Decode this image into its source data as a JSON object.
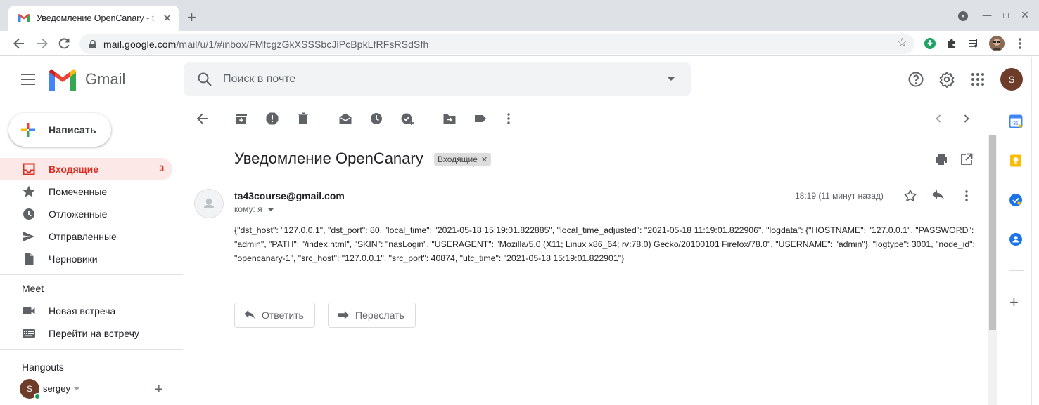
{
  "browser": {
    "tab_title": "Уведомление OpenCanary - t",
    "url_host": "mail.google.com",
    "url_path": "/mail/u/1/#inbox/FMfcgzGkXSSSbcJlPcBpkLfRFsRSdSfh"
  },
  "header": {
    "app_name": "Gmail",
    "search_placeholder": "Поиск в почте",
    "avatar_letter": "S"
  },
  "compose_label": "Написать",
  "nav": [
    {
      "label": "Входящие",
      "count": "3",
      "icon": "inbox-icon"
    },
    {
      "label": "Помеченные",
      "count": "",
      "icon": "star-icon"
    },
    {
      "label": "Отложенные",
      "count": "",
      "icon": "clock-icon"
    },
    {
      "label": "Отправленные",
      "count": "",
      "icon": "send-icon"
    },
    {
      "label": "Черновики",
      "count": "",
      "icon": "draft-icon"
    }
  ],
  "meet": {
    "heading": "Meet",
    "items": [
      "Новая встреча",
      "Перейти на встречу"
    ]
  },
  "hangouts": {
    "heading": "Hangouts",
    "user_name": "sergey",
    "avatar_letter": "S"
  },
  "message": {
    "subject": "Уведомление OpenCanary",
    "label": "Входящие",
    "sender": "ta43course@gmail.com",
    "to": "кому: я",
    "time": "18:19 (11 минут назад)",
    "body": "{\"dst_host\": \"127.0.0.1\", \"dst_port\": 80, \"local_time\": \"2021-05-18 15:19:01.822885\", \"local_time_adjusted\": \"2021-05-18 11:19:01.822906\", \"logdata\": {\"HOSTNAME\": \"127.0.0.1\", \"PASSWORD\": \"admin\", \"PATH\": \"/index.html\", \"SKIN\": \"nasLogin\", \"USERAGENT\": \"Mozilla/5.0 (X11; Linux x86_64; rv:78.0) Gecko/20100101 Firefox/78.0\", \"USERNAME\": \"admin\"}, \"logtype\": 3001, \"node_id\": \"opencanary-1\", \"src_host\": \"127.0.0.1\", \"src_port\": 40874, \"utc_time\": \"2021-05-18 15:19:01.822901\"}",
    "reply_label": "Ответить",
    "forward_label": "Переслать"
  },
  "colors": {
    "active_nav_bg": "#fce8e6",
    "active_nav_text": "#d93025",
    "chrome_tabstrip": "#dee1e6"
  }
}
